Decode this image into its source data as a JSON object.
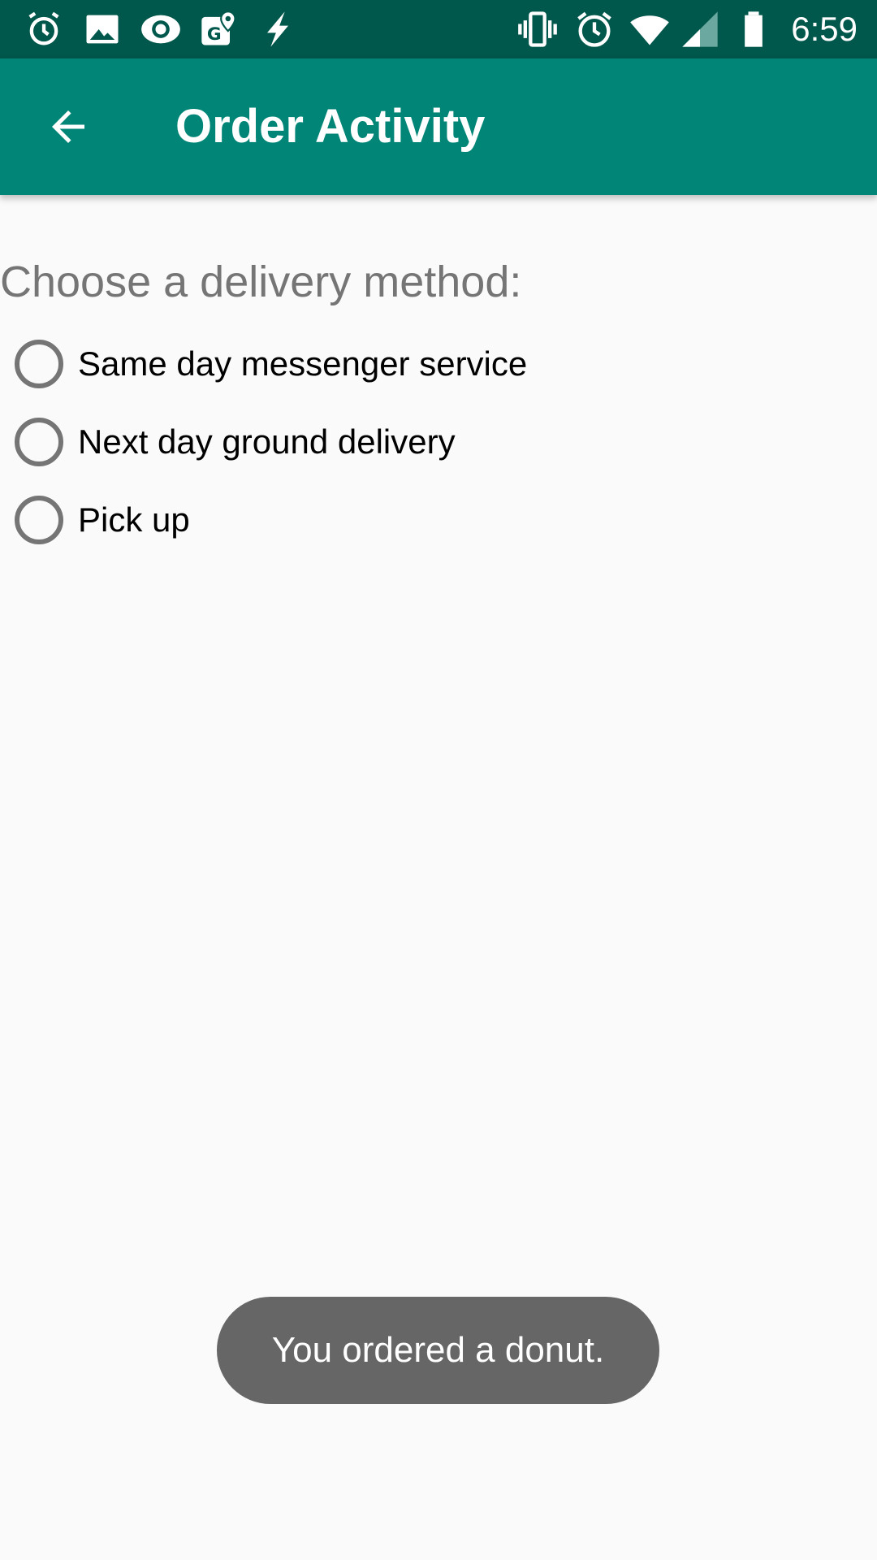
{
  "status_bar": {
    "left_icons": [
      "alarm-clock-icon",
      "image-icon",
      "eye-icon",
      "map-pin-icon",
      "bolt-icon"
    ],
    "right_icons": [
      "vibrate-icon",
      "alarm-icon",
      "wifi-icon",
      "cell-signal-icon",
      "battery-icon"
    ],
    "time": "6:59",
    "background_color": "#00574b"
  },
  "app_bar": {
    "title": "Order Activity",
    "nav_icon": "arrow-back-icon",
    "background_color": "#008577"
  },
  "delivery": {
    "prompt": "Choose a delivery method:",
    "options": [
      {
        "label": "Same day messenger service",
        "checked": false
      },
      {
        "label": "Next day ground delivery",
        "checked": false
      },
      {
        "label": "Pick up",
        "checked": false
      }
    ]
  },
  "toast": {
    "message": "You ordered a donut."
  }
}
